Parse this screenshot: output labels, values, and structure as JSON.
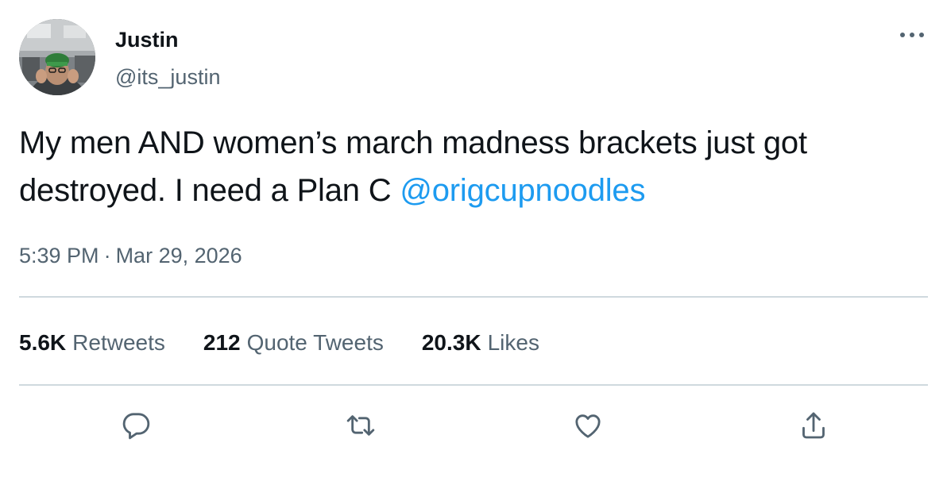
{
  "author": {
    "display_name": "Justin",
    "handle": "@its_justin"
  },
  "tweet": {
    "text_before": "My men AND women’s march madness brackets just got destroyed. I need a Plan C ",
    "mention": "@origcupnoodles"
  },
  "meta": {
    "time": "5:39 PM",
    "separator": "·",
    "date": "Mar 29, 2026"
  },
  "stats": {
    "retweets": {
      "count": "5.6K",
      "label": "Retweets"
    },
    "quotes": {
      "count": "212",
      "label": "Quote Tweets"
    },
    "likes": {
      "count": "20.3K",
      "label": "Likes"
    }
  },
  "actions": {
    "icons": [
      "reply-icon",
      "retweet-icon",
      "like-icon",
      "share-icon"
    ]
  },
  "colors": {
    "text": "#0f1419",
    "secondary": "#536471",
    "link": "#1d9bf0",
    "divider": "#cfd9de"
  }
}
